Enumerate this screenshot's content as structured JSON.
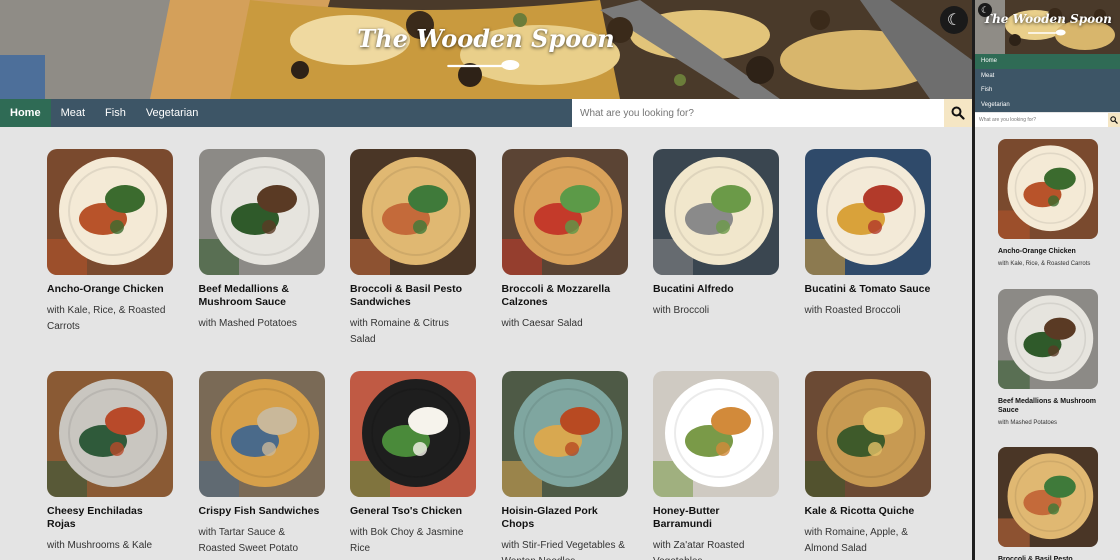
{
  "site": {
    "title": "The Wooden Spoon"
  },
  "nav": {
    "items": [
      "Home",
      "Meat",
      "Fish",
      "Vegetarian"
    ],
    "active": 0
  },
  "search": {
    "placeholder": "What are you looking for?"
  },
  "recipes": [
    {
      "title": "Ancho-Orange Chicken",
      "subtitle": "with Kale, Rice, & Roasted Carrots"
    },
    {
      "title": "Beef Medallions & Mushroom Sauce",
      "subtitle": "with Mashed Potatoes"
    },
    {
      "title": "Broccoli & Basil Pesto Sandwiches",
      "subtitle": "with Romaine & Citrus Salad"
    },
    {
      "title": "Broccoli & Mozzarella Calzones",
      "subtitle": "with Caesar Salad"
    },
    {
      "title": "Bucatini Alfredo",
      "subtitle": "with Broccoli"
    },
    {
      "title": "Bucatini & Tomato Sauce",
      "subtitle": "with Roasted Broccoli"
    },
    {
      "title": "Cheesy Enchiladas Rojas",
      "subtitle": "with Mushrooms & Kale"
    },
    {
      "title": "Crispy Fish Sandwiches",
      "subtitle": "with Tartar Sauce & Roasted Sweet Potato"
    },
    {
      "title": "General Tso's Chicken",
      "subtitle": "with Bok Choy & Jasmine Rice"
    },
    {
      "title": "Hoisin-Glazed Pork Chops",
      "subtitle": "with Stir-Fried Vegetables & Wonton Noodles"
    },
    {
      "title": "Honey-Butter Barramundi",
      "subtitle": "with Za'atar Roasted Vegetables"
    },
    {
      "title": "Kale & Ricotta Quiche",
      "subtitle": "with Romaine, Apple, & Almond Salad"
    }
  ],
  "icons": {
    "theme": "moon-icon",
    "search": "search-icon",
    "logo": "spoon-icon"
  },
  "colors": {
    "nav": "#3d5566",
    "active": "#2f6b55",
    "search_button": "#f5e6c4",
    "page": "#e4e4e4"
  }
}
